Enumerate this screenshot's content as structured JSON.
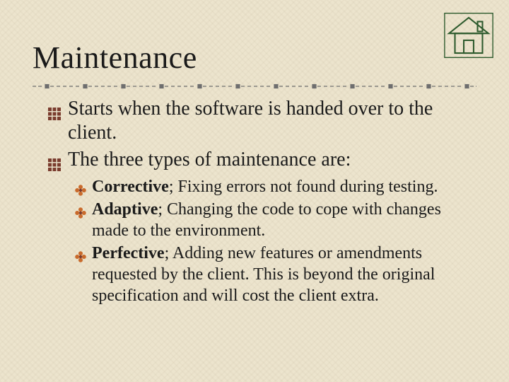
{
  "title": "Maintenance",
  "colors": {
    "bullet1": "#7a3c2e",
    "bullet2_lobe": "#c96a2b",
    "bullet2_center": "#7a3c2e",
    "divider": "#6e6e6e",
    "house_outline": "#2e5b2e"
  },
  "level1": [
    {
      "text": "Starts when the software is handed over to the client."
    },
    {
      "text": "The three types of maintenance are:"
    }
  ],
  "level2": [
    {
      "label": "Corrective",
      "rest": "; Fixing errors not found during testing."
    },
    {
      "label": "Adaptive",
      "rest": "; Changing the code to cope with changes made to the environment."
    },
    {
      "label": "Perfective",
      "rest": "; Adding new features or amendments requested by the client. This is beyond the original specification and will cost the client extra."
    }
  ]
}
